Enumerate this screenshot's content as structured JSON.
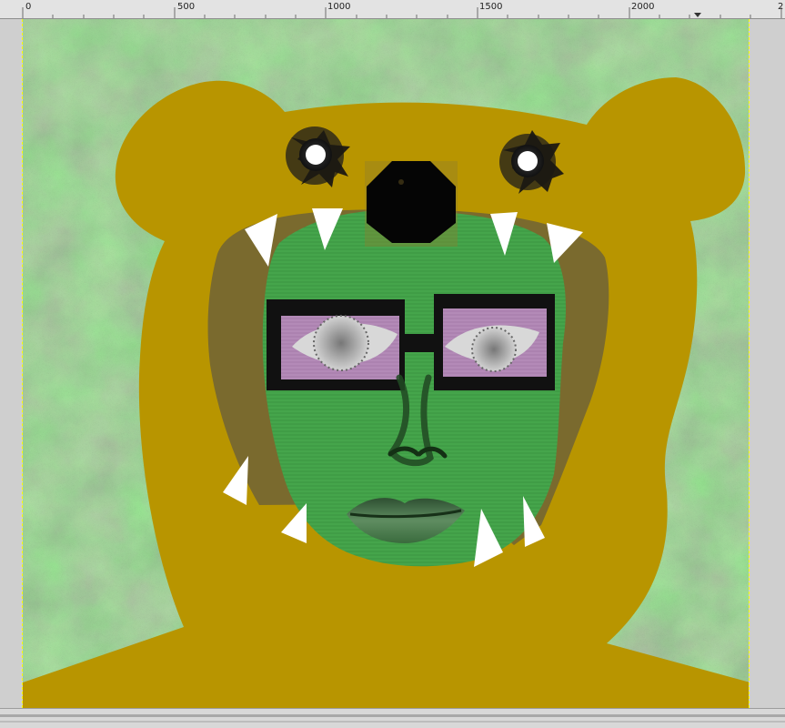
{
  "ruler": {
    "labels": [
      "0",
      "500",
      "1000",
      "1500",
      "2000",
      "2"
    ]
  },
  "icons": {
    "ruler_marker": "triangle-down-icon",
    "bullet_hole": "bullet-hole-icon"
  },
  "colors": {
    "background_green": "#5f9f62",
    "bear_gold": "#b89500",
    "inner_brown": "#7d6b2c",
    "face_green": "#47a74c",
    "glasses_black": "#111111",
    "lens_purple": "#b48ab6"
  }
}
